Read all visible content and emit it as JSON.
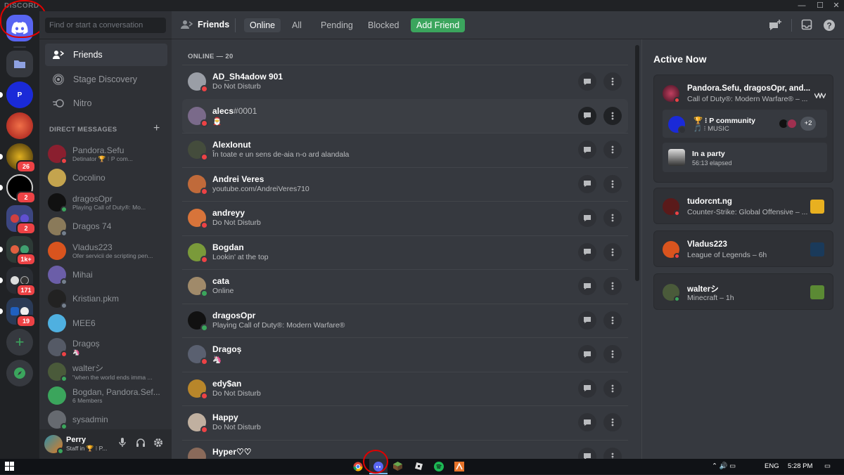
{
  "window": {
    "brand": "DISCORD",
    "min": "—",
    "max": "☐",
    "close": "✕"
  },
  "servers": [
    {
      "name": "home",
      "badge": ""
    },
    {
      "name": "folder",
      "badge": ""
    },
    {
      "name": "p-community",
      "badge": ""
    },
    {
      "name": "server-red",
      "badge": ""
    },
    {
      "name": "server-gold",
      "badge": "26"
    },
    {
      "name": "server-dark",
      "badge": "2"
    },
    {
      "name": "server-folder-blue",
      "badge": "2"
    },
    {
      "name": "server-group-green",
      "badge": "1k+"
    },
    {
      "name": "server-group-mixed",
      "badge": "171"
    },
    {
      "name": "server-group-r",
      "badge": "19"
    }
  ],
  "sidebar": {
    "search_placeholder": "Find or start a conversation",
    "nav": [
      {
        "label": "Friends",
        "icon": "friends-icon"
      },
      {
        "label": "Stage Discovery",
        "icon": "stage-icon"
      },
      {
        "label": "Nitro",
        "icon": "nitro-icon"
      }
    ],
    "dm_header": "DIRECT MESSAGES",
    "dms": [
      {
        "name": "Pandora.Sefu",
        "sub": "Detinator 🏆 ⁝ P com...",
        "color": "#8a1f2f",
        "status": "#ed4245"
      },
      {
        "name": "Cocolino",
        "sub": "",
        "color": "#c4a44e",
        "status": ""
      },
      {
        "name": "dragosOpr",
        "sub": "Playing Call of Duty®: Mo...",
        "color": "#111111",
        "status": "#3ba55c"
      },
      {
        "name": "Dragos 74",
        "sub": "",
        "color": "#8a7a5a",
        "status": "#747f8d"
      },
      {
        "name": "Vladus223",
        "sub": "Ofer servicii de scripting pen...",
        "color": "#d9541e",
        "status": ""
      },
      {
        "name": "Mihai",
        "sub": "",
        "color": "#6b5ea8",
        "status": "#747f8d"
      },
      {
        "name": "Kristian.pkm",
        "sub": "",
        "color": "#222222",
        "status": "#747f8d"
      },
      {
        "name": "MEE6",
        "sub": "",
        "color": "#4fb0e0",
        "status": ""
      },
      {
        "name": "Dragoș",
        "sub": "🦄",
        "color": "#555a66",
        "status": "#ed4245"
      },
      {
        "name": "walterシ",
        "sub": "\"when the world ends imma ...",
        "color": "#4a5a3a",
        "status": "#3ba55c"
      },
      {
        "name": "Bogdan, Pandora.Sef...",
        "sub": "6 Members",
        "color": "#3ba55c",
        "status": ""
      },
      {
        "name": "sysadmin",
        "sub": "",
        "color": "#666a70",
        "status": "#3ba55c"
      }
    ],
    "user": {
      "name": "Perry",
      "sub": "Staff in 🏆 ⁝ P..."
    }
  },
  "topbar": {
    "title": "Friends",
    "tabs": [
      "Online",
      "All",
      "Pending",
      "Blocked"
    ],
    "add_friend": "Add Friend"
  },
  "friends": {
    "header": "ONLINE — 20",
    "list": [
      {
        "name": "AD_Sh4adow 901",
        "tag": "",
        "sub": "Do Not Disturb",
        "color": "#9a9ea6",
        "status": "#ed4245"
      },
      {
        "name": "alecs",
        "tag": "#0001",
        "sub": "🎅",
        "color": "#7a6a8a",
        "status": "#ed4245"
      },
      {
        "name": "AlexIonut",
        "tag": "",
        "sub": "În toate e un sens de-aia n-o ard alandala",
        "color": "#444c3c",
        "status": "#ed4245"
      },
      {
        "name": "Andrei Veres",
        "tag": "",
        "sub": "youtube.com/AndreiVeres710",
        "color": "#c06a3a",
        "status": "#ed4245"
      },
      {
        "name": "andreyy",
        "tag": "",
        "sub": "Do Not Disturb",
        "color": "#d8743a",
        "status": "#ed4245"
      },
      {
        "name": "Bogdan",
        "tag": "",
        "sub": "Lookin' at the top",
        "color": "#7a9a3a",
        "status": "#ed4245"
      },
      {
        "name": "cata",
        "tag": "",
        "sub": "Online",
        "color": "#a08a6a",
        "status": "#3ba55c"
      },
      {
        "name": "dragosOpr",
        "tag": "",
        "sub": "Playing Call of Duty®: Modern Warfare®",
        "color": "#111111",
        "status": "#3ba55c"
      },
      {
        "name": "Dragoș",
        "tag": "",
        "sub": "🦄",
        "color": "#5a6070",
        "status": "#ed4245"
      },
      {
        "name": "edy$an",
        "tag": "",
        "sub": "Do Not Disturb",
        "color": "#b8862a",
        "status": "#ed4245"
      },
      {
        "name": "Happy",
        "tag": "",
        "sub": "Do Not Disturb",
        "color": "#c0b0a0",
        "status": "#ed4245"
      },
      {
        "name": "Hyper♡♡",
        "tag": "",
        "sub": "",
        "color": "#8a6a5a",
        "status": "#ed4245"
      }
    ]
  },
  "active_now": {
    "title": "Active Now",
    "card1": {
      "name": "Pandora.Sefu, dragosOpr, and...",
      "sub": "Call of Duty®: Modern Warfare® – ...",
      "server_name": "🏆 ⁝ P community",
      "channel": "🎵 ⁝ MUSIC",
      "extra": "+2",
      "party_title": "In a party",
      "party_sub": "56:13 elapsed"
    },
    "cards": [
      {
        "name": "tudorcnt.ng",
        "sub": "Counter-Strike: Global Offensive – ...",
        "color": "#5a1a1a",
        "game_color": "#e8b020"
      },
      {
        "name": "Vladus223",
        "sub": "League of Legends – 6h",
        "color": "#d9541e",
        "game_color": "#1a3a5a"
      },
      {
        "name": "walterシ",
        "sub": "Minecraft – 1h",
        "color": "#4a5a3a",
        "game_color": "#5b8a34"
      }
    ]
  },
  "taskbar": {
    "lang": "ENG",
    "time": "5:28 PM"
  }
}
